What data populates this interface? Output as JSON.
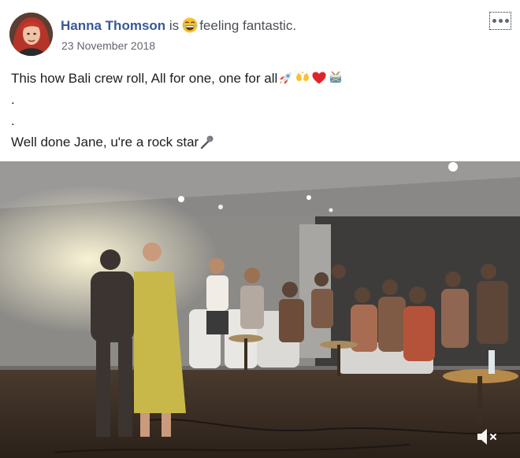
{
  "post": {
    "author_name": "Hanna Thomson",
    "is_text": "is",
    "feeling_text": "feeling fantastic.",
    "feeling_icon": "grinning-face-icon",
    "date": "23 November 2018",
    "more_icon": "more-options-icon"
  },
  "body": {
    "line1": "This how Bali crew roll, All for one, one for all",
    "line1_emojis": [
      "rocket-icon",
      "hands-icon",
      "red-heart-icon",
      "drum-icon"
    ],
    "line2": ".",
    "line3": ".",
    "line4": "Well done Jane, u're a rock star",
    "line4_emojis": [
      "microphone-icon"
    ]
  },
  "video": {
    "mute_icon": "speaker-muted-icon"
  },
  "colors": {
    "author_link": "#385898",
    "secondary_text": "#616770",
    "body_text": "#1c1e21"
  }
}
